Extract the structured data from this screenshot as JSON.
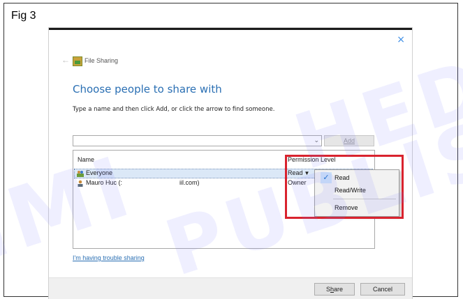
{
  "figure": {
    "label": "Fig 3"
  },
  "watermark": {
    "parts": [
      "IMI",
      "PUBLIS",
      "HED"
    ]
  },
  "window": {
    "title": "File Sharing",
    "close_glyph": "×",
    "back_glyph": "←"
  },
  "content": {
    "heading": "Choose people to share with",
    "instructions": "Type a name and then click Add, or click the arrow to find someone.",
    "name_input": {
      "value": "",
      "placeholder": ""
    },
    "add_label": "Add",
    "table": {
      "headers": {
        "name": "Name",
        "permission": "Permission Level"
      },
      "rows": [
        {
          "name": "Everyone",
          "email": "",
          "permission": "Read",
          "selected": true
        },
        {
          "name": "Mauro Huc (:",
          "email": "iil.com)",
          "permission": "Owner",
          "selected": false
        }
      ]
    },
    "permission_menu": {
      "items": [
        {
          "label": "Read",
          "checked": true
        },
        {
          "label": "Read/Write",
          "checked": false
        },
        {
          "label": "Remove",
          "checked": false
        }
      ]
    },
    "trouble_link": "I'm having trouble sharing"
  },
  "footer": {
    "share_prefix": "S",
    "share_ul": "h",
    "share_suffix": "are",
    "cancel_label": "Cancel"
  },
  "colors": {
    "accent": "#2a6fb3",
    "highlight": "#d9232e",
    "selection": "#dbe8f7"
  },
  "icons": {
    "app": "file-sharing-icon",
    "user_group": "users-icon",
    "user": "user-icon",
    "check": "checkmark-icon",
    "dropdown": "chevron-down-icon"
  }
}
